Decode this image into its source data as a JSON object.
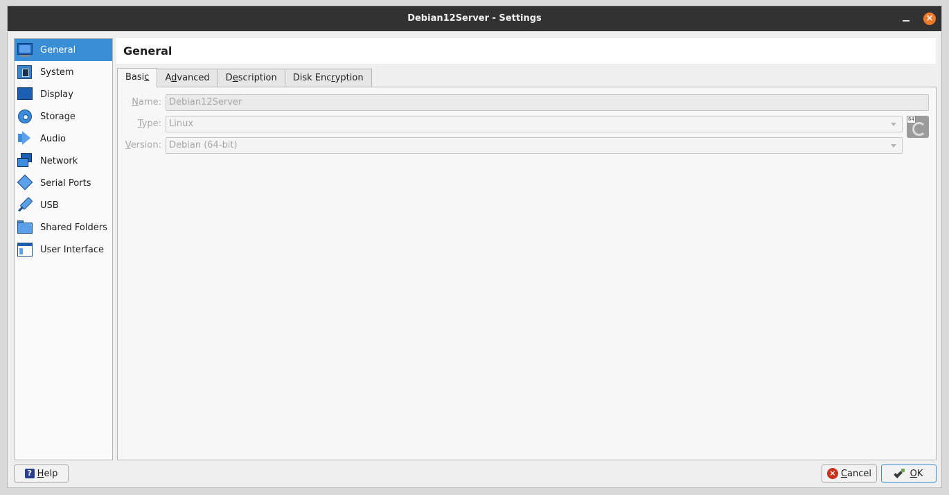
{
  "window": {
    "title": "Debian12Server - Settings",
    "close_glyph": "×"
  },
  "sidebar": {
    "items": [
      {
        "label": "General",
        "icon": "monitor-icon",
        "active": true
      },
      {
        "label": "System",
        "icon": "motherboard-icon"
      },
      {
        "label": "Display",
        "icon": "display-icon"
      },
      {
        "label": "Storage",
        "icon": "disk-icon"
      },
      {
        "label": "Audio",
        "icon": "speaker-icon"
      },
      {
        "label": "Network",
        "icon": "network-icon"
      },
      {
        "label": "Serial Ports",
        "icon": "serial-port-icon"
      },
      {
        "label": "USB",
        "icon": "usb-icon"
      },
      {
        "label": "Shared Folders",
        "icon": "folder-icon"
      },
      {
        "label": "User Interface",
        "icon": "user-interface-icon"
      }
    ]
  },
  "page": {
    "heading": "General"
  },
  "tabs": {
    "basic": {
      "pre": "Basi",
      "mnemonic": "c",
      "post": ""
    },
    "advanced": {
      "pre": "A",
      "mnemonic": "d",
      "post": "vanced"
    },
    "description": {
      "pre": "D",
      "mnemonic": "e",
      "post": "scription"
    },
    "disk_encryption": {
      "pre": "Disk Enc",
      "mnemonic": "r",
      "post": "yption"
    },
    "active": "Basic"
  },
  "form": {
    "name": {
      "label_mnemonic": "N",
      "label_rest": "ame:",
      "value": "Debian12Server"
    },
    "type": {
      "label_mnemonic": "T",
      "label_rest": "ype:",
      "value": "Linux"
    },
    "version": {
      "label_mnemonic": "V",
      "label_rest": "ersion:",
      "value": "Debian (64-bit)"
    },
    "os_badge": "64"
  },
  "buttons": {
    "help": {
      "mnemonic": "H",
      "rest": "elp",
      "glyph": "?"
    },
    "cancel": {
      "mnemonic": "C",
      "rest": "ancel",
      "glyph": "×"
    },
    "ok": {
      "mnemonic": "O",
      "rest": "K"
    }
  },
  "colors": {
    "accent": "#3a8ed6",
    "titlebar": "#323232",
    "close": "#f07a2a"
  }
}
